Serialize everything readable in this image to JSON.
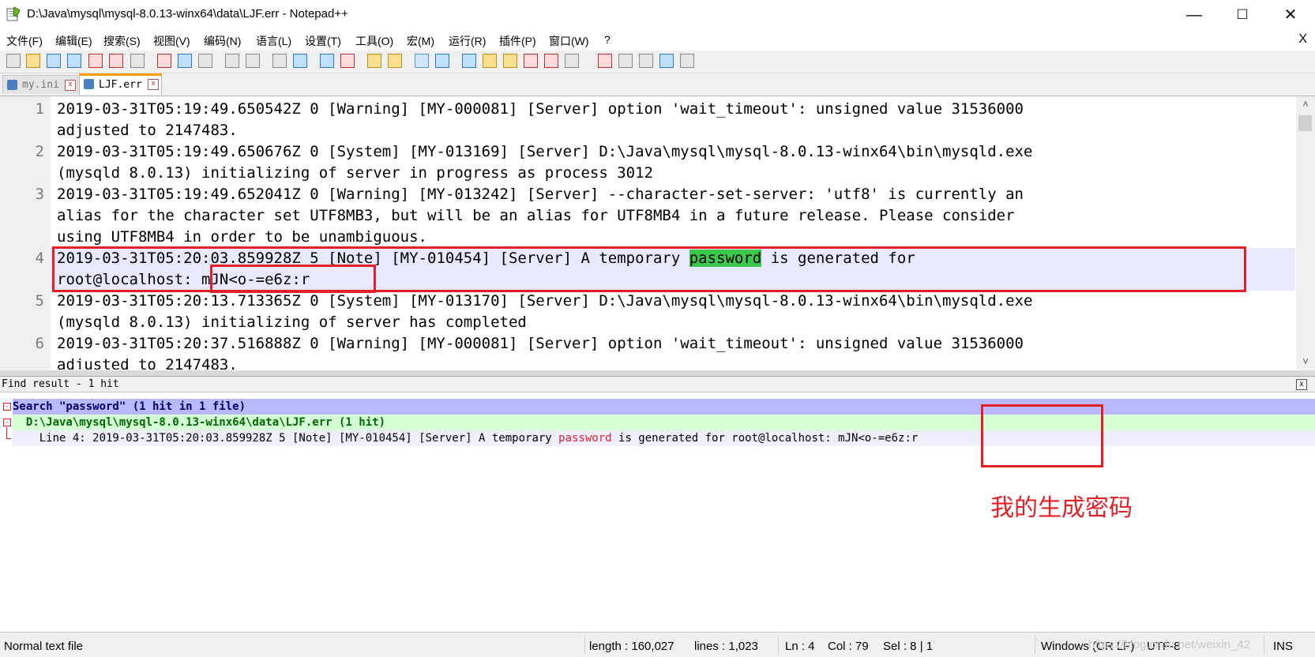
{
  "window": {
    "title": "D:\\Java\\mysql\\mysql-8.0.13-winx64\\data\\LJF.err - Notepad++",
    "minimize": "—",
    "maximize": "☐",
    "close": "✕"
  },
  "menu": {
    "items": [
      "文件(F)",
      "编辑(E)",
      "搜索(S)",
      "视图(V)",
      "编码(N)",
      "语言(L)",
      "设置(T)",
      "工具(O)",
      "宏(M)",
      "运行(R)",
      "插件(P)",
      "窗口(W)",
      "?"
    ],
    "close": "X"
  },
  "toolbar": {
    "icons": [
      "new-file-icon",
      "open-file-icon",
      "save-icon",
      "save-all-icon",
      "close-icon",
      "close-all-icon",
      "print-icon",
      "cut-icon",
      "copy-icon",
      "paste-icon",
      "undo-icon",
      "redo-icon",
      "find-icon",
      "replace-icon",
      "zoom-in-icon",
      "zoom-out-icon",
      "sync-vertical-icon",
      "sync-horizontal-icon",
      "word-wrap-icon",
      "show-all-chars-icon",
      "indent-guide-icon",
      "doc-map-icon",
      "function-list-icon",
      "folder-workspace-icon",
      "monitor-icon",
      "record-macro-icon",
      "stop-macro-icon",
      "play-macro-icon",
      "play-multiple-icon",
      "save-macro-icon"
    ]
  },
  "tabs": [
    {
      "label": "my.ini",
      "active": false
    },
    {
      "label": "LJF.err",
      "active": true
    }
  ],
  "editor": {
    "lines": [
      {
        "num": "1",
        "text": "2019-03-31T05:19:49.650542Z 0 [Warning] [MY-000081] [Server] option 'wait_timeout': unsigned value 31536000",
        "cont": [
          "adjusted to 2147483."
        ]
      },
      {
        "num": "2",
        "text": "2019-03-31T05:19:49.650676Z 0 [System] [MY-013169] [Server] D:\\Java\\mysql\\mysql-8.0.13-winx64\\bin\\mysqld.exe",
        "cont": [
          "(mysqld 8.0.13) initializing of server in progress as process 3012"
        ]
      },
      {
        "num": "3",
        "text": "2019-03-31T05:19:49.652041Z 0 [Warning] [MY-013242] [Server] --character-set-server: 'utf8' is currently an",
        "cont": [
          "alias for the character set UTF8MB3, but will be an alias for UTF8MB4 in a future release. Please consider",
          "using UTF8MB4 in order to be unambiguous."
        ]
      },
      {
        "num": "4",
        "text_before": "2019-03-31T05:20:03.859928Z 5 [Note] [MY-010454] [Server] A temporary ",
        "highlight": "password",
        "text_after": " is generated for",
        "cont": [
          "root@localhost: mJN<o-=e6z:r"
        ]
      },
      {
        "num": "5",
        "text": "2019-03-31T05:20:13.713365Z 0 [System] [MY-013170] [Server] D:\\Java\\mysql\\mysql-8.0.13-winx64\\bin\\mysqld.exe",
        "cont": [
          "(mysqld 8.0.13) initializing of server has completed"
        ]
      },
      {
        "num": "6",
        "text": "2019-03-31T05:20:37.516888Z 0 [Warning] [MY-000081] [Server] option 'wait_timeout': unsigned value 31536000",
        "cont": [
          "adjusted to 2147483."
        ]
      }
    ]
  },
  "find_results": {
    "header": "Find result - 1 hit",
    "search_line": "Search \"password\" (1 hit in 1 file)",
    "file_line": "  D:\\Java\\mysql\\mysql-8.0.13-winx64\\data\\LJF.err (1 hit)",
    "result_prefix": "    Line 4: 2019-03-31T05:20:03.859928Z 5 [Note] [MY-010454] [Server] A temporary ",
    "result_match": "password",
    "result_suffix": " is generated for root@localhost: mJN<o-=e6z:r"
  },
  "annotation": "我的生成密码",
  "status": {
    "file_type": "Normal text file",
    "length": "length : 160,027",
    "lines": "lines : 1,023",
    "ln": "Ln : 4",
    "col": "Col : 79",
    "sel": "Sel : 8 | 1",
    "eol": "Windows (CR LF)",
    "encoding": "UTF-8",
    "mode": "INS"
  },
  "watermark": "https://blog.csdn.net/weixin_42"
}
